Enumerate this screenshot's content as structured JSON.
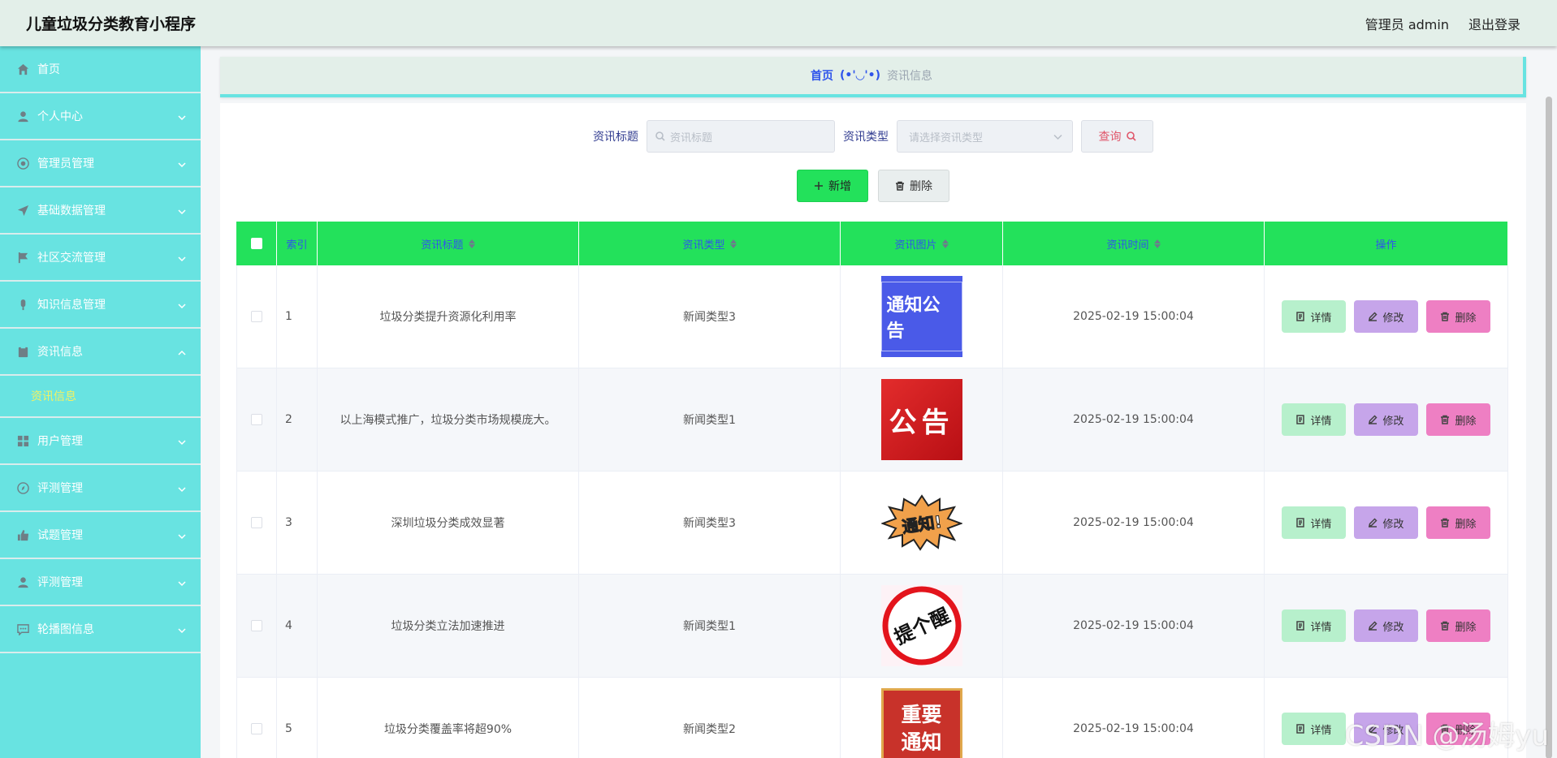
{
  "header": {
    "app_title": "儿童垃圾分类教育小程序",
    "admin_label": "管理员 admin",
    "logout_label": "退出登录"
  },
  "sidebar": {
    "items": [
      {
        "label": "首页",
        "icon": "home-icon"
      },
      {
        "label": "个人中心",
        "icon": "user-icon"
      },
      {
        "label": "管理员管理",
        "icon": "settings-icon"
      },
      {
        "label": "基础数据管理",
        "icon": "send-icon"
      },
      {
        "label": "社区交流管理",
        "icon": "flag-icon"
      },
      {
        "label": "知识信息管理",
        "icon": "mic-icon"
      },
      {
        "label": "资讯信息",
        "icon": "clipboard-icon"
      },
      {
        "label": "用户管理",
        "icon": "grid-icon"
      },
      {
        "label": "评测管理",
        "icon": "compass-icon"
      },
      {
        "label": "试题管理",
        "icon": "thumb-icon"
      },
      {
        "label": "评测管理",
        "icon": "user-icon"
      },
      {
        "label": "轮播图信息",
        "icon": "chat-icon"
      }
    ],
    "active_submenu": "资讯信息"
  },
  "breadcrumb": {
    "home": "首页",
    "separator": "(•'◡'•)",
    "current": "资讯信息"
  },
  "search": {
    "title_label": "资讯标题",
    "title_placeholder": "资讯标题",
    "type_label": "资讯类型",
    "type_placeholder": "请选择资讯类型",
    "query_label": "查询"
  },
  "actions": {
    "add_label": "新增",
    "delete_label": "删除"
  },
  "table": {
    "headers": {
      "index": "索引",
      "title": "资讯标题",
      "type": "资讯类型",
      "image": "资讯图片",
      "time": "资讯时间",
      "ops": "操作"
    },
    "rows": [
      {
        "index": "1",
        "title": "垃圾分类提升资源化利用率",
        "type": "新闻类型3",
        "image_text": "通知公告",
        "time": "2025-02-19 15:00:04"
      },
      {
        "index": "2",
        "title": "以上海模式推广，垃圾分类市场规模庞大。",
        "type": "新闻类型1",
        "image_text": "公告",
        "time": "2025-02-19 15:00:04"
      },
      {
        "index": "3",
        "title": "深圳垃圾分类成效显著",
        "type": "新闻类型3",
        "image_text": "通知!",
        "time": "2025-02-19 15:00:04"
      },
      {
        "index": "4",
        "title": "垃圾分类立法加速推进",
        "type": "新闻类型1",
        "image_text": "提个醒",
        "time": "2025-02-19 15:00:04"
      },
      {
        "index": "5",
        "title": "垃圾分类覆盖率将超90%",
        "type": "新闻类型2",
        "image_text_line1": "重要",
        "image_text_line2": "通知",
        "time": "2025-02-19 15:00:04"
      }
    ],
    "op_detail": "详情",
    "op_edit": "修改",
    "op_delete": "删除"
  },
  "watermark": "CSDN @汤姆yu"
}
